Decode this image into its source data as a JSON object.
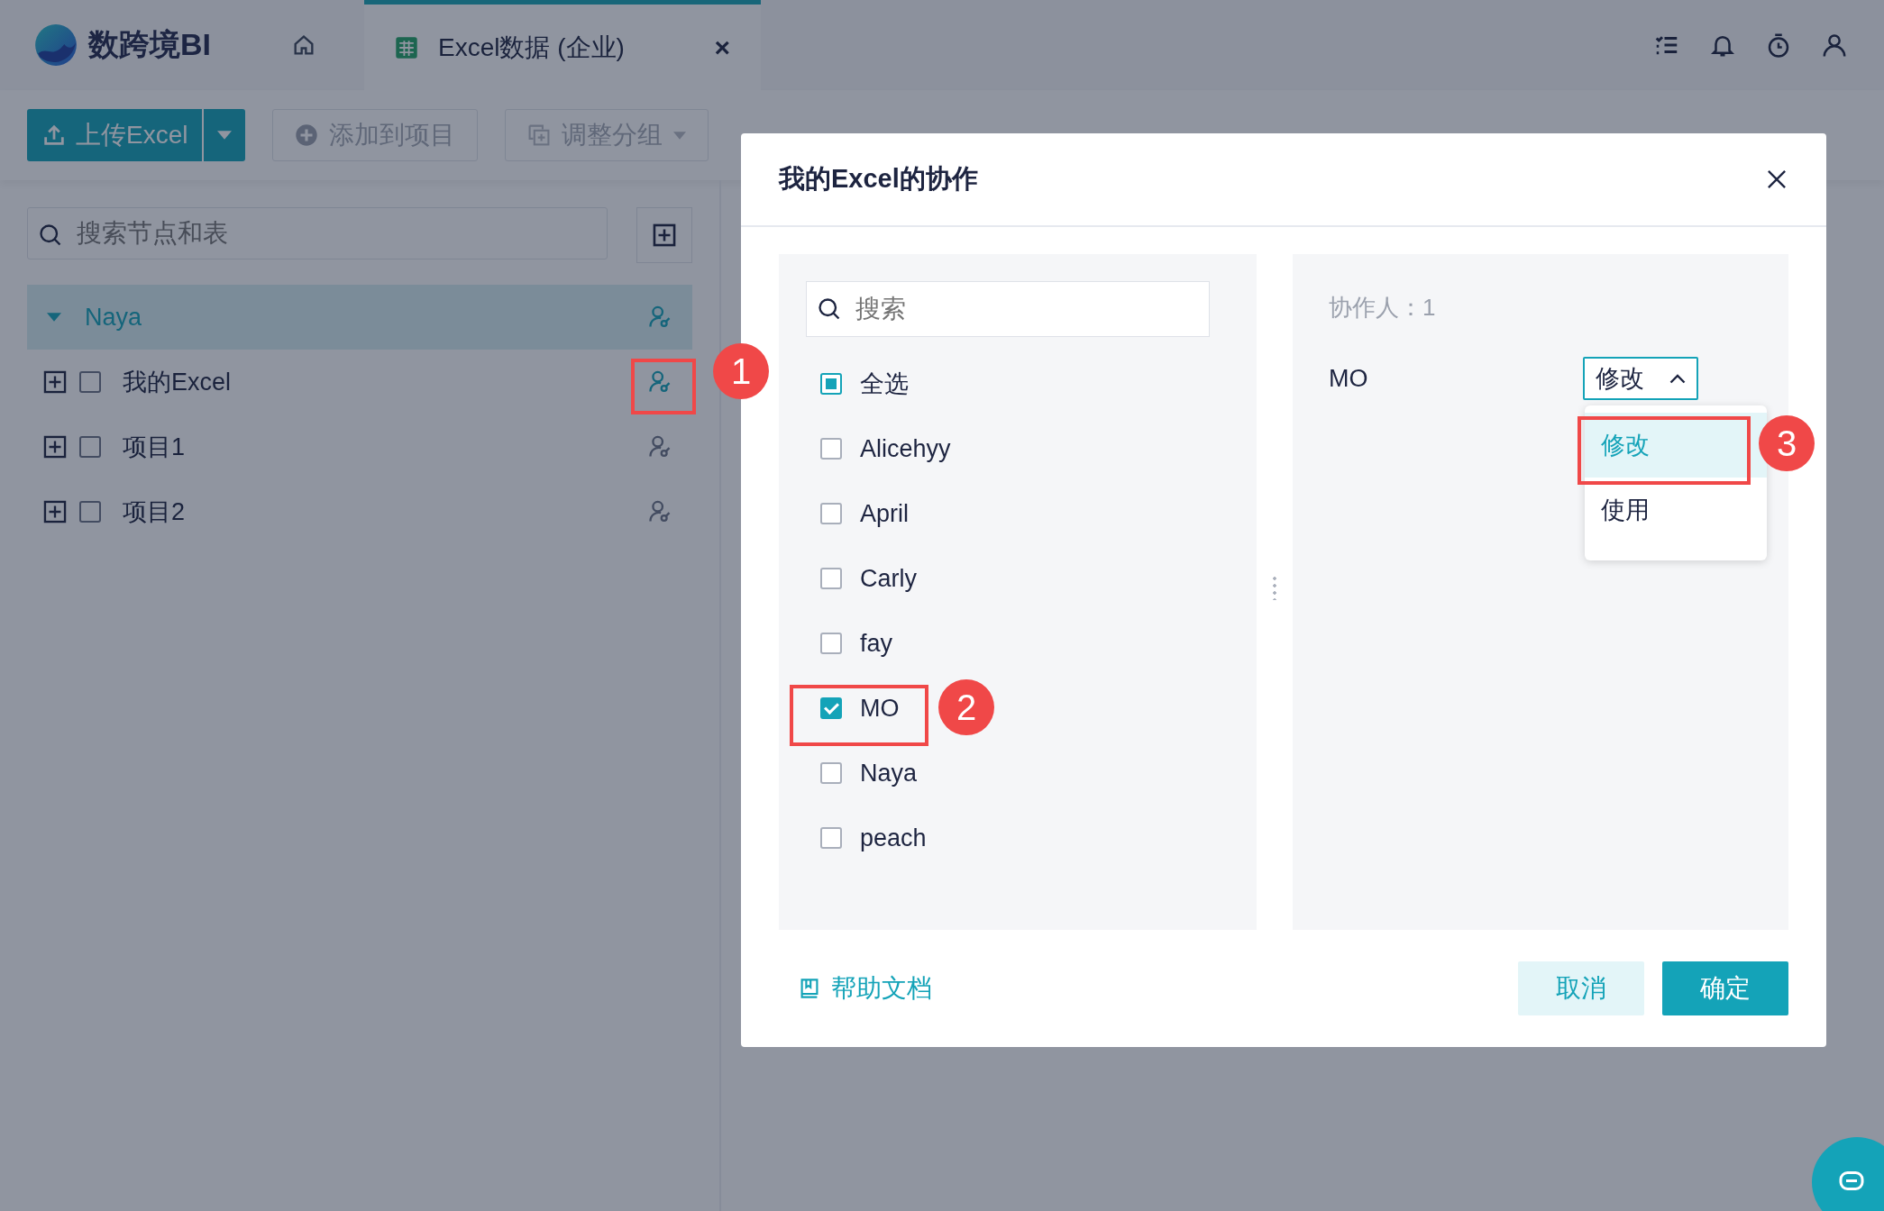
{
  "header": {
    "logo_text": "数跨境BI",
    "tabs": [
      {
        "label": "Excel数据 (企业)",
        "selected": true,
        "close": "×"
      }
    ]
  },
  "toolbar": {
    "upload": "上传Excel",
    "add_to_project": "添加到项目",
    "regroup": "调整分组"
  },
  "sidebar": {
    "search": {
      "placeholder": "搜索节点和表"
    },
    "tree": [
      {
        "label": "Naya",
        "expanded": true,
        "selected": true,
        "icon_active": true,
        "children": [
          {
            "label": "我的Excel",
            "checked": false,
            "icon_active": true
          },
          {
            "label": "项目1",
            "checked": false,
            "icon_active": false
          },
          {
            "label": "项目2",
            "checked": false,
            "icon_active": false
          }
        ]
      }
    ]
  },
  "dialog": {
    "title": "我的Excel的协作",
    "search": {
      "placeholder": "搜索"
    },
    "select_all": {
      "label": "全选",
      "checked": false,
      "indeterminate": true
    },
    "users": [
      {
        "label": "Alicehyy",
        "checked": false
      },
      {
        "label": "April",
        "checked": false
      },
      {
        "label": "Carly",
        "checked": false
      },
      {
        "label": "fay",
        "checked": false
      },
      {
        "label": "MO",
        "checked": true
      },
      {
        "label": "Naya",
        "checked": false
      },
      {
        "label": "peach",
        "checked": false
      }
    ],
    "collaborator_count": "协作人：1",
    "collaborators": [
      {
        "name": "MO",
        "permission": "修改",
        "expanded": true,
        "options": [
          {
            "label": "修改",
            "selected": true
          },
          {
            "label": "使用",
            "selected": false
          }
        ]
      }
    ],
    "help": "帮助文档",
    "cancel": "取消",
    "ok": "确定"
  },
  "annotations": [
    "1",
    "2",
    "3"
  ]
}
